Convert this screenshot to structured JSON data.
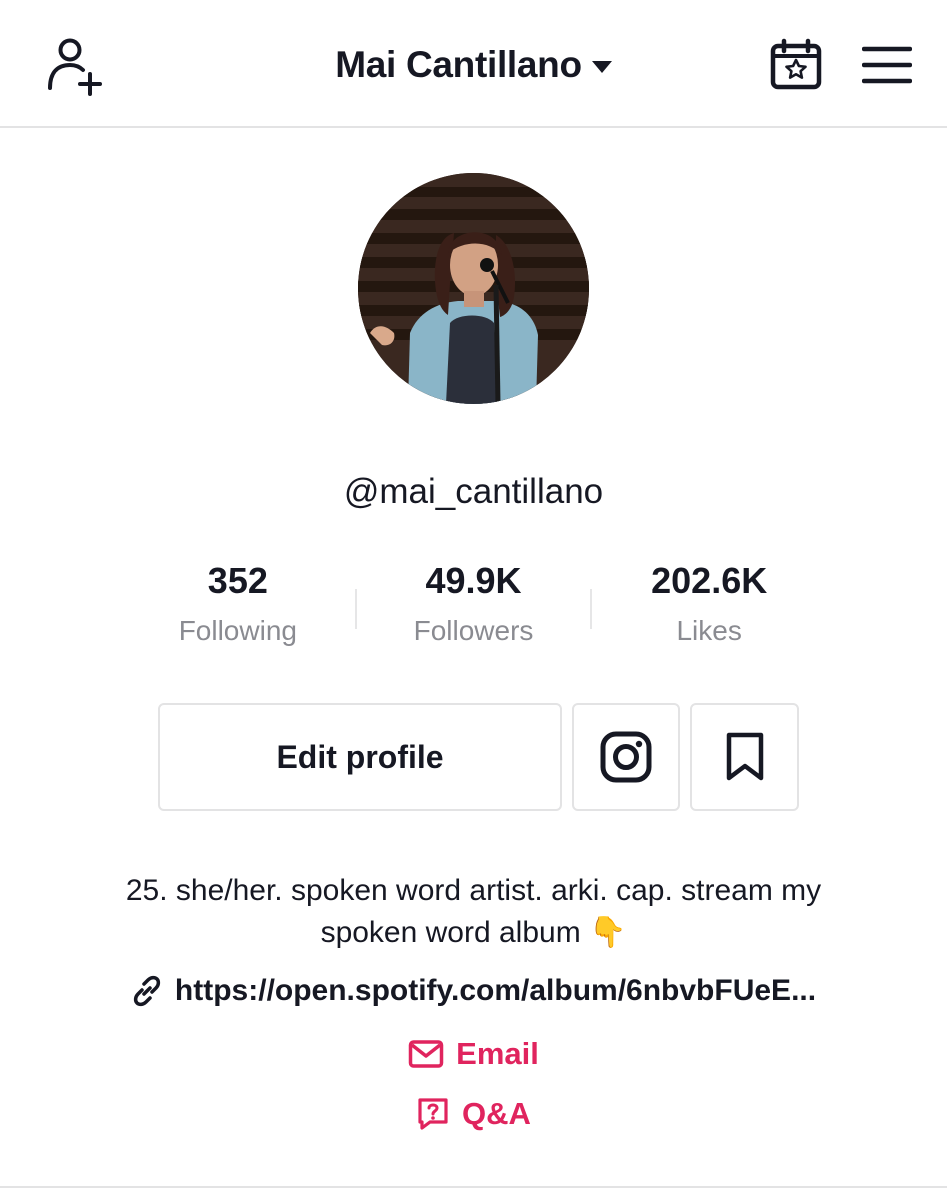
{
  "header": {
    "title": "Mai Cantillano",
    "icons": {
      "left": "add-user-icon",
      "calendar": "calendar-star-icon",
      "menu": "hamburger-menu-icon",
      "dropdown": "caret-down-icon"
    }
  },
  "profile": {
    "avatar": "avatar-photo",
    "username": "@mai_cantillano"
  },
  "stats": [
    {
      "value": "352",
      "label": "Following"
    },
    {
      "value": "49.9K",
      "label": "Followers"
    },
    {
      "value": "202.6K",
      "label": "Likes"
    }
  ],
  "actions": {
    "edit_label": "Edit profile",
    "instagram_icon": "instagram-icon",
    "bookmark_icon": "bookmark-icon"
  },
  "bio": {
    "text": "25. she/her. spoken word artist. arki. cap. stream my spoken word album",
    "emoji": "👇"
  },
  "link": {
    "icon": "link-icon",
    "url": "https://open.spotify.com/album/6nbvbFUeE..."
  },
  "contacts": {
    "email_label": "Email",
    "qa_label": "Q&A"
  },
  "colors": {
    "text": "#161823",
    "muted": "#8a8b91",
    "accent": "#e0245e",
    "border": "#e3e3e4"
  }
}
